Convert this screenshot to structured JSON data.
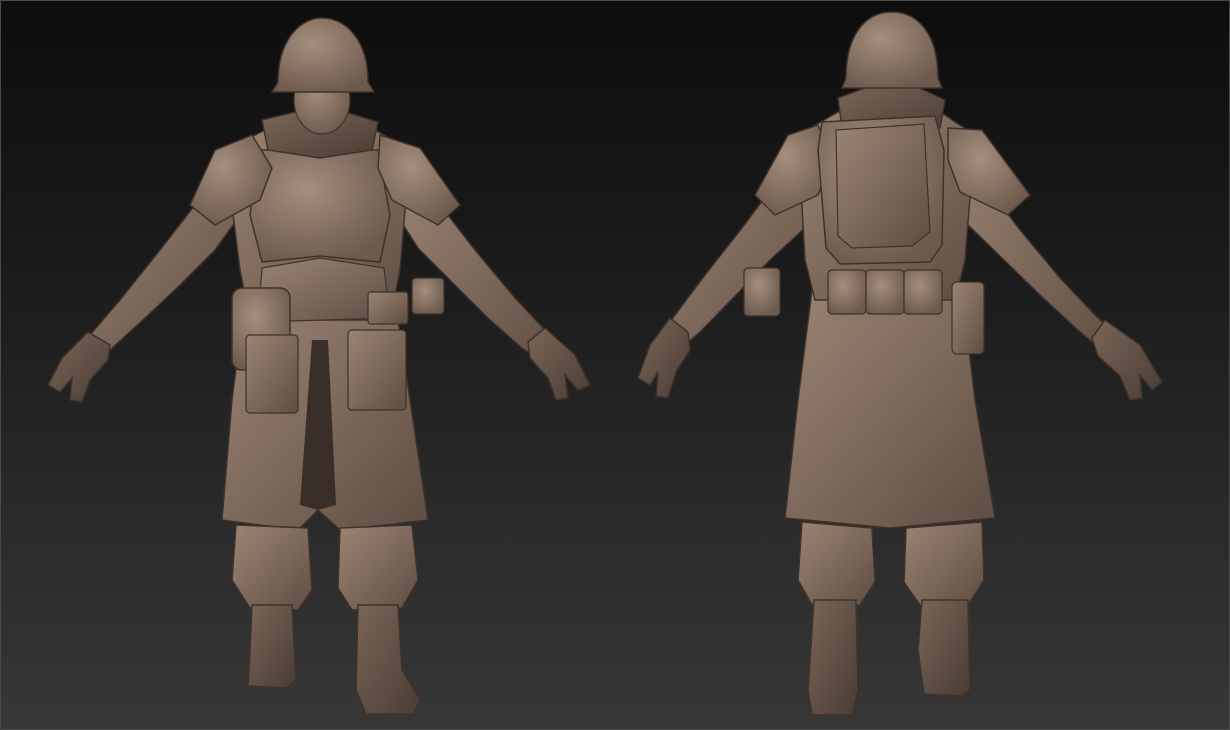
{
  "scene": {
    "views": [
      {
        "name": "front-view"
      },
      {
        "name": "back-view"
      }
    ],
    "material_color": "#8a7566",
    "background_top": "#0d0d0d",
    "background_bottom": "#373737"
  }
}
